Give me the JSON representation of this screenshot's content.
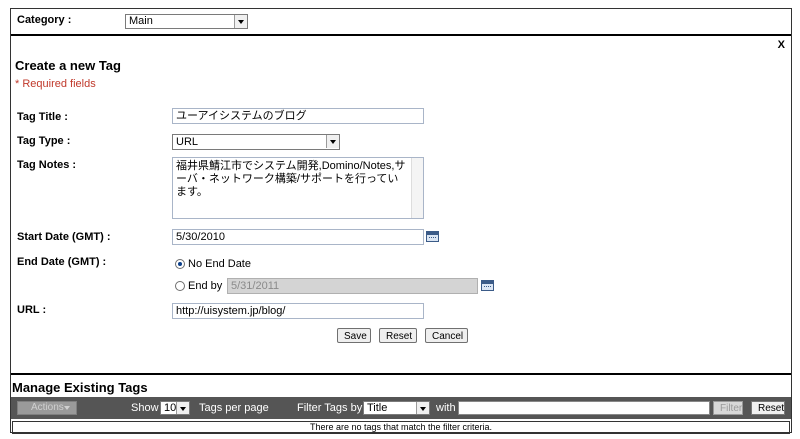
{
  "topbar": {
    "category_label": "Category :",
    "category_value": "Main"
  },
  "form": {
    "close_label": "X",
    "title": "Create a new Tag",
    "required_note": "* Required fields",
    "tag_title_label": "Tag Title :",
    "tag_title_value": "ユーアイシステムのブログ",
    "tag_type_label": "Tag Type :",
    "tag_type_value": "URL",
    "tag_notes_label": "Tag Notes :",
    "tag_notes_value": "福井県鯖江市でシステム開発,Domino/Notes,サーバ・ネットワーク構築/サポートを行っています。",
    "start_date_label": "Start Date (GMT) :",
    "start_date_value": "5/30/2010",
    "end_date_label": "End Date (GMT) :",
    "no_end_date_label": "No End Date",
    "end_by_label": "End by",
    "end_by_value": "5/31/2011",
    "url_label": "URL :",
    "url_value": "http://uisystem.jp/blog/",
    "save_label": "Save",
    "reset_label": "Reset",
    "cancel_label": "Cancel"
  },
  "manage": {
    "title": "Manage Existing Tags",
    "actions_label": "Actions",
    "show_label": "Show",
    "per_page_value": "10",
    "per_page_label": "Tags per page",
    "filter_by_label": "Filter Tags by",
    "filter_field_value": "Title",
    "with_label": "with",
    "filter_button": "Filter",
    "reset_button": "Reset",
    "empty_message": "There are no tags that match the filter criteria."
  },
  "colors": {
    "toolbar_bg": "#555555",
    "required_text": "#c0392b",
    "radio_selected": "#0b3f8a"
  }
}
